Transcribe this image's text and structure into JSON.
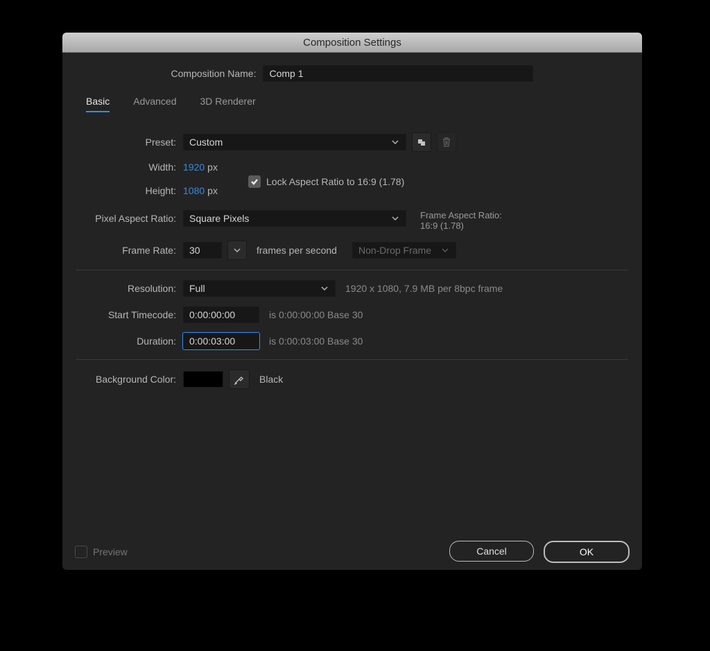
{
  "title": "Composition Settings",
  "comp_name_label": "Composition Name:",
  "comp_name_value": "Comp 1",
  "tabs": {
    "basic": "Basic",
    "advanced": "Advanced",
    "renderer": "3D Renderer"
  },
  "preset": {
    "label": "Preset:",
    "value": "Custom"
  },
  "width": {
    "label": "Width:",
    "value": "1920",
    "unit": "px"
  },
  "height": {
    "label": "Height:",
    "value": "1080",
    "unit": "px"
  },
  "lock_label": "Lock Aspect Ratio to 16:9 (1.78)",
  "par": {
    "label": "Pixel Aspect Ratio:",
    "value": "Square Pixels"
  },
  "far": {
    "label": "Frame Aspect Ratio:",
    "value": "16:9 (1.78)"
  },
  "fps": {
    "label": "Frame Rate:",
    "value": "30",
    "suffix": "frames per second",
    "drop": "Non-Drop Frame"
  },
  "res": {
    "label": "Resolution:",
    "value": "Full",
    "info": "1920 x 1080, 7.9 MB per 8bpc frame"
  },
  "start": {
    "label": "Start Timecode:",
    "value": "0:00:00:00",
    "info": "is 0:00:00:00  Base 30"
  },
  "dur": {
    "label": "Duration:",
    "value": "0:00:03:00",
    "info": "is 0:00:03:00  Base 30"
  },
  "bg": {
    "label": "Background Color:",
    "name": "Black"
  },
  "footer": {
    "preview": "Preview",
    "cancel": "Cancel",
    "ok": "OK"
  }
}
